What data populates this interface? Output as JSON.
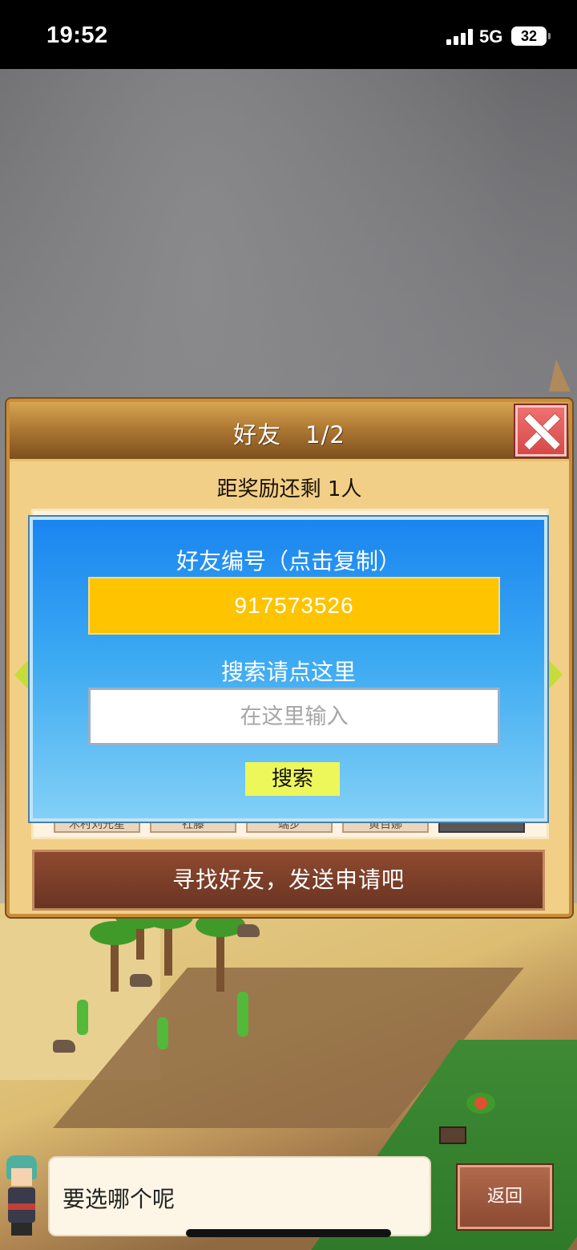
{
  "status_bar": {
    "time": "19:52",
    "network": "5G",
    "battery": "32"
  },
  "panel": {
    "title": "好友",
    "page": "1/2",
    "reward_text": "距奖励还剩 1人",
    "find_friend_button": "寻找好友，发送申请吧",
    "slot_names": [
      "木村刘光星",
      "社藤",
      "端步",
      "黄百娜"
    ]
  },
  "id_dialog": {
    "id_label": "好友编号（点击复制）",
    "friend_id": "917573526",
    "search_hint": "搜索请点这里",
    "search_placeholder": "在这里输入",
    "search_value": "",
    "search_button": "搜索"
  },
  "dialog": {
    "speech_text": "要选哪个呢",
    "back_button": "返回"
  },
  "colors": {
    "id_box": "#fec400",
    "dialog_blue": "#1a85f0",
    "search_button": "#eef75a",
    "find_button": "#8e4a30",
    "close_button": "#e05858"
  },
  "icons": {
    "close": "close-icon",
    "prev": "arrow-left-icon",
    "next": "arrow-right-icon"
  }
}
